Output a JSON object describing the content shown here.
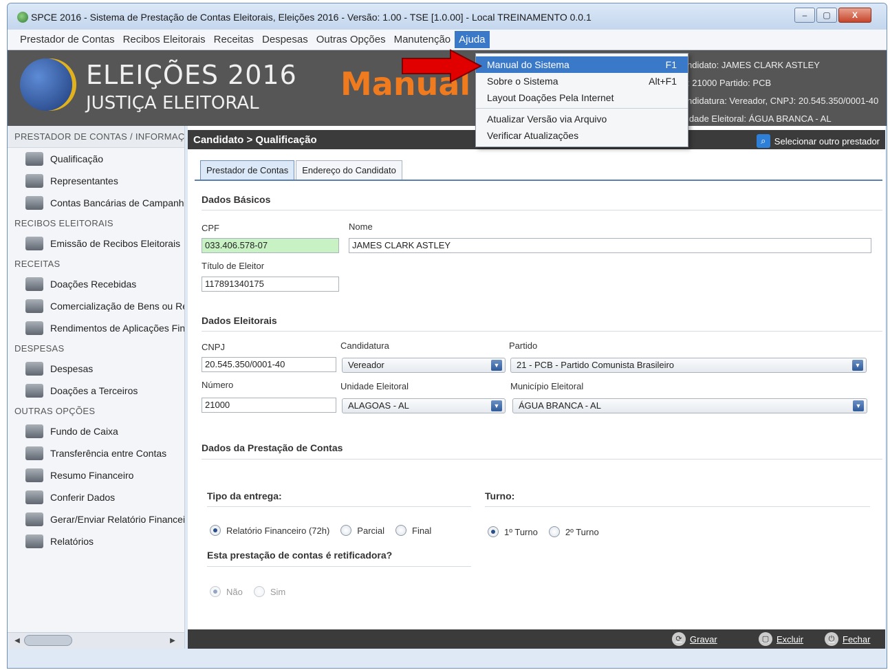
{
  "window": {
    "title": "SPCE 2016 - Sistema de Prestação de Contas Eleitorais, Eleições 2016 - Versão: 1.00  -  TSE [1.0.00] - Local TREINAMENTO 0.0.1",
    "controls": {
      "minimize": "–",
      "maximize": "▢",
      "close": "X"
    }
  },
  "menubar": [
    "Prestador de Contas",
    "Recibos Eleitorais",
    "Receitas",
    "Despesas",
    "Outras Opções",
    "Manutenção",
    "Ajuda"
  ],
  "help_menu": [
    {
      "label": "Manual do Sistema",
      "shortcut": "F1"
    },
    {
      "label": "Sobre o Sistema",
      "shortcut": "Alt+F1"
    },
    {
      "label": "Layout Doações Pela Internet",
      "shortcut": ""
    },
    {
      "label": "Atualizar Versão via Arquivo",
      "shortcut": ""
    },
    {
      "label": "Verificar Atualizações",
      "shortcut": ""
    }
  ],
  "banner": {
    "title": "ELEIÇÕES 2016",
    "subtitle": "JUSTIÇA ELEITORAL",
    "overlay": "Manual",
    "info": [
      "ndidato: JAMES CLARK ASTLEY",
      ": 21000 Partido: PCB",
      "ndidatura: Vereador, CNPJ: 20.545.350/0001-40",
      "idade Eleitoral: ÁGUA BRANCA - AL"
    ]
  },
  "sidebar": {
    "top_header": "PRESTADOR DE CONTAS / INFORMAÇ",
    "groups": [
      {
        "header": "",
        "items": [
          "Qualificação",
          "Representantes",
          "Contas Bancárias de Campanh"
        ]
      },
      {
        "header": "RECIBOS ELEITORAIS",
        "items": [
          "Emissão de Recibos Eleitorais"
        ]
      },
      {
        "header": "RECEITAS",
        "items": [
          "Doações Recebidas",
          "Comercialização de Bens ou Re",
          "Rendimentos de Aplicações Fin"
        ]
      },
      {
        "header": "DESPESAS",
        "items": [
          "Despesas",
          "Doações a Terceiros"
        ]
      },
      {
        "header": "OUTRAS OPÇÕES",
        "items": [
          "Fundo de Caixa",
          "Transferência entre Contas",
          "Resumo Financeiro",
          "Conferir Dados",
          "Gerar/Enviar Relatório Financeir",
          "Relatórios"
        ]
      }
    ]
  },
  "content": {
    "breadcrumb": "Candidato > Qualificação",
    "select_other": "Selecionar outro prestador",
    "tabs": [
      "Prestador de Contas",
      "Endereço do Candidato"
    ],
    "dados_basicos": {
      "title": "Dados Básicos",
      "cpf_label": "CPF",
      "cpf": "033.406.578-07",
      "nome_label": "Nome",
      "nome": "JAMES CLARK ASTLEY",
      "titulo_label": "Título de Eleitor",
      "titulo": "117891340175"
    },
    "dados_eleitorais": {
      "title": "Dados Eleitorais",
      "cnpj_label": "CNPJ",
      "cnpj": "20.545.350/0001-40",
      "candidatura_label": "Candidatura",
      "candidatura": "Vereador",
      "partido_label": "Partido",
      "partido": "21 - PCB - Partido Comunista Brasileiro",
      "numero_label": "Número",
      "numero": "21000",
      "unidade_label": "Unidade Eleitoral",
      "unidade": "ALAGOAS - AL",
      "municipio_label": "Município Eleitoral",
      "municipio": "ÁGUA BRANCA - AL"
    },
    "prestacao": {
      "title": "Dados da Prestação de Contas",
      "tipo_label": "Tipo da entrega:",
      "tipo_options": [
        "Relatório Financeiro (72h)",
        "Parcial",
        "Final"
      ],
      "turno_label": "Turno:",
      "turno_options": [
        "1º Turno",
        "2º Turno"
      ],
      "retificadora_label": "Esta prestação de contas é retificadora?",
      "retificadora_options": [
        "Não",
        "Sim"
      ]
    },
    "footer": {
      "gravar": "Gravar",
      "excluir": "Excluir",
      "fechar": "Fechar"
    }
  }
}
